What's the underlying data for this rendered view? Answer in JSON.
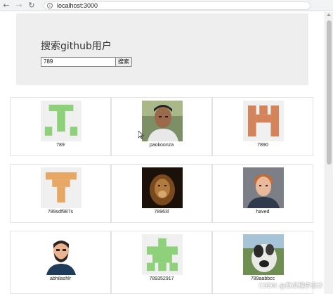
{
  "browser": {
    "back_icon": "arrow-left-icon",
    "forward_icon": "arrow-right-icon",
    "reload_icon": "reload-icon",
    "site_info_icon": "info-icon",
    "url": "localhost:3000"
  },
  "search": {
    "title": "搜索github用户",
    "input_value": "789",
    "button_label": "搜索"
  },
  "users": [
    {
      "login": "789",
      "avatar": "identicon-green"
    },
    {
      "login": "paokoonza",
      "avatar": "photo-selfie"
    },
    {
      "login": "7890",
      "avatar": "identicon-orange-h"
    },
    {
      "login": "789sdf987s",
      "avatar": "identicon-orange-t"
    },
    {
      "login": "78963l",
      "avatar": "photo-lion"
    },
    {
      "login": "haved",
      "avatar": "photo-portrait"
    },
    {
      "login": "abhilashlr",
      "avatar": "cartoon-bearded-man"
    },
    {
      "login": "789352917",
      "avatar": "identicon-green-cross"
    },
    {
      "login": "789aabbcc",
      "avatar": "photo-dog"
    }
  ],
  "watermark": "CSDN @西瓜程序设计",
  "colors": {
    "jumbotron_bg": "#eeeeee",
    "identicon_green": "#8fd17a",
    "identicon_orange": "#d4845a",
    "identicon_orange_t": "#e7a866"
  }
}
